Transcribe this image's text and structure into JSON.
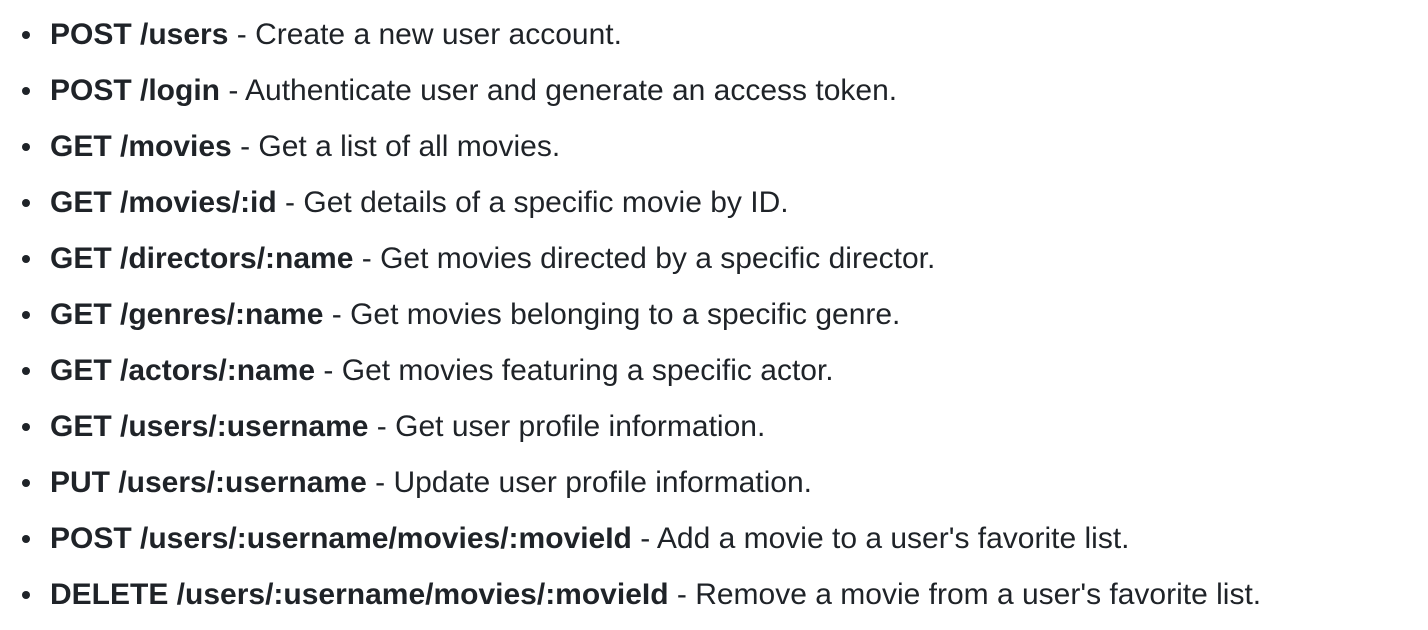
{
  "endpoints": [
    {
      "route": "POST /users",
      "description": " - Create a new user account."
    },
    {
      "route": "POST /login",
      "description": " - Authenticate user and generate an access token."
    },
    {
      "route": "GET /movies",
      "description": " - Get a list of all movies."
    },
    {
      "route": "GET /movies/:id",
      "description": " - Get details of a specific movie by ID."
    },
    {
      "route": "GET /directors/:name",
      "description": " - Get movies directed by a specific director."
    },
    {
      "route": "GET /genres/:name",
      "description": " - Get movies belonging to a specific genre."
    },
    {
      "route": "GET /actors/:name",
      "description": " - Get movies featuring a specific actor."
    },
    {
      "route": "GET /users/:username",
      "description": " - Get user profile information."
    },
    {
      "route": "PUT /users/:username",
      "description": " - Update user profile information."
    },
    {
      "route": "POST /users/:username/movies/:movieId",
      "description": " - Add a movie to a user's favorite list."
    },
    {
      "route": "DELETE /users/:username/movies/:movieId",
      "description": " - Remove a movie from a user's favorite list."
    }
  ]
}
